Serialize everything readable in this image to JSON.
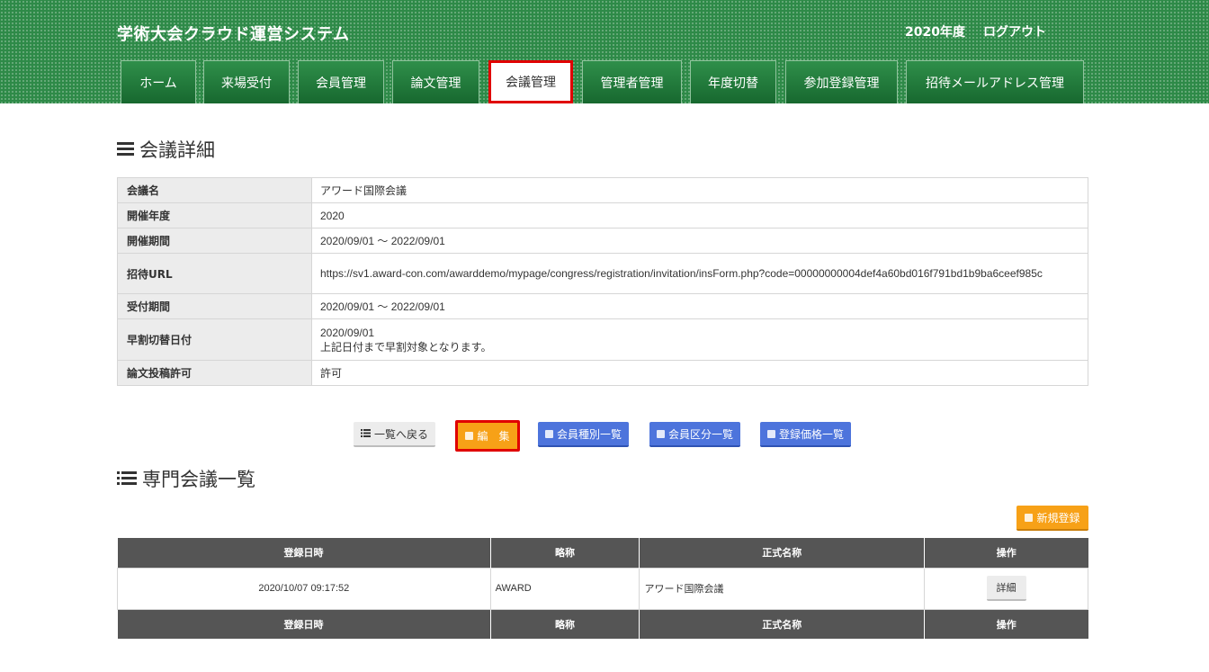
{
  "header": {
    "app_title": "学術大会クラウド運営システム",
    "year": "2020年度",
    "logout": "ログアウト"
  },
  "nav": {
    "tabs": [
      {
        "label": "ホーム"
      },
      {
        "label": "来場受付"
      },
      {
        "label": "会員管理"
      },
      {
        "label": "論文管理"
      },
      {
        "label": "会議管理",
        "active": true
      },
      {
        "label": "管理者管理"
      },
      {
        "label": "年度切替"
      },
      {
        "label": "参加登録管理"
      },
      {
        "label": "招待メールアドレス管理"
      }
    ]
  },
  "detail": {
    "title": "会議詳細",
    "rows": [
      {
        "label": "会議名",
        "value": "アワード国際会議"
      },
      {
        "label": "開催年度",
        "value": "2020"
      },
      {
        "label": "開催期間",
        "value": "2020/09/01 ～ 2022/09/01"
      },
      {
        "label": "招待URL",
        "value": "https://sv1.award-con.com/awarddemo/mypage/congress/registration/invitation/insForm.php?code=00000000004def4a60bd016f791bd1b9ba6ceef985c"
      },
      {
        "label": "受付期間",
        "value": "2020/09/01 ～ 2022/09/01"
      },
      {
        "label": "早割切替日付",
        "value": "2020/09/01",
        "note": "上記日付まで早割対象となります。"
      },
      {
        "label": "論文投稿許可",
        "value": "許可"
      }
    ]
  },
  "actions": {
    "back": "一覧へ戻る",
    "edit": "編　集",
    "member_types": "会員種別一覧",
    "member_categories": "会員区分一覧",
    "price_list": "登録価格一覧"
  },
  "sub_list": {
    "title": "専門会議一覧",
    "new_button": "新規登録",
    "columns": [
      "登録日時",
      "略称",
      "正式名称",
      "操作"
    ],
    "rows": [
      {
        "registered": "2020/10/07 09:17:52",
        "abbr": "AWARD",
        "name": "アワード国際会議",
        "action": "詳細"
      }
    ]
  },
  "colors": {
    "header_green": "#2e8a48",
    "highlight_red": "#e00000",
    "orange": "#f7a117",
    "blue": "#4d74dc"
  }
}
